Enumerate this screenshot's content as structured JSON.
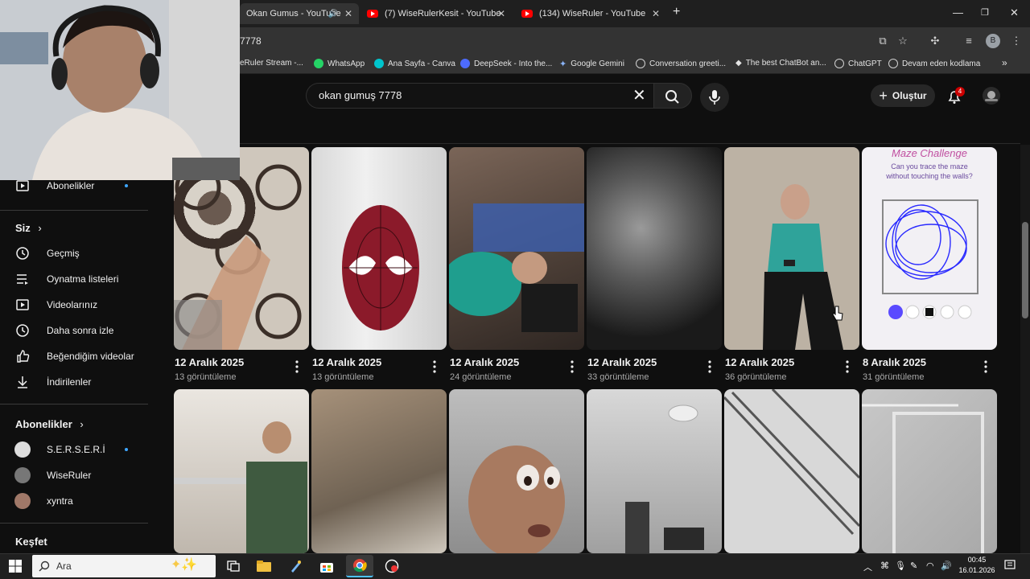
{
  "browser": {
    "tabs": [
      {
        "title": "Okan Gumus - YouTube",
        "active": true,
        "audio": true
      },
      {
        "title": "(7) WiseRulerKesit - YouTube",
        "active": false
      },
      {
        "title": "(134) WiseRuler - YouTube",
        "active": false
      }
    ],
    "address": "7778",
    "profile_initial": "B",
    "bookmarks": [
      {
        "label": "eRuler Stream -...",
        "icon": "youtube-icon",
        "color": "#ff0000"
      },
      {
        "label": "WhatsApp",
        "icon": "whatsapp-icon",
        "color": "#25d366"
      },
      {
        "label": "Ana Sayfa - Canva",
        "icon": "canva-icon",
        "color": "#00c4cc"
      },
      {
        "label": "DeepSeek - Into the...",
        "icon": "deepseek-icon",
        "color": "#4d6bfe"
      },
      {
        "label": "Google Gemini",
        "icon": "gemini-icon",
        "color": "#8ab4f8"
      },
      {
        "label": "Conversation greeti...",
        "icon": "chatgpt-icon",
        "color": "#d0d0d0"
      },
      {
        "label": "The best ChatBot an...",
        "icon": "chatbot-icon",
        "color": "#ffffff"
      },
      {
        "label": "ChatGPT",
        "icon": "chatgpt-icon",
        "color": "#d0d0d0"
      },
      {
        "label": "Devam eden kodlama",
        "icon": "chatgpt-icon",
        "color": "#d0d0d0"
      }
    ]
  },
  "youtube": {
    "search_query": "okan gumuş 7778",
    "create_label": "Oluştur",
    "notification_count": "4"
  },
  "sidebar": {
    "subscriptions_link": "Abonelikler",
    "you_heading": "Siz",
    "you_items": [
      {
        "label": "Geçmiş",
        "icon": "history-icon"
      },
      {
        "label": "Oynatma listeleri",
        "icon": "playlists-icon"
      },
      {
        "label": "Videolarınız",
        "icon": "your-videos-icon"
      },
      {
        "label": "Daha sonra izle",
        "icon": "watch-later-icon"
      },
      {
        "label": "Beğendiğim videolar",
        "icon": "liked-videos-icon"
      },
      {
        "label": "İndirilenler",
        "icon": "downloads-icon"
      }
    ],
    "subs_heading": "Abonelikler",
    "channels": [
      {
        "name": "S.E.R.S.E.R.İ",
        "new": true
      },
      {
        "name": "WiseRuler",
        "new": false
      },
      {
        "name": "xyntra",
        "new": false
      }
    ],
    "explore_heading": "Keşfet"
  },
  "videos_row1": [
    {
      "date": "12 Aralık 2025",
      "views": "13 görüntüleme"
    },
    {
      "date": "12 Aralık 2025",
      "views": "13 görüntüleme"
    },
    {
      "date": "12 Aralık 2025",
      "views": "24 görüntüleme"
    },
    {
      "date": "12 Aralık 2025",
      "views": "33 görüntüleme"
    },
    {
      "date": "12 Aralık 2025",
      "views": "36 görüntüleme"
    },
    {
      "date": "8 Aralık 2025",
      "views": "31 görüntüleme"
    }
  ],
  "thumb6_text": {
    "title": "Maze Challenge",
    "subtitle": "Can you trace the maze without touching the walls?"
  },
  "taskbar": {
    "search_placeholder": "Ara",
    "time": "00:45",
    "date": "16.01.2026"
  }
}
